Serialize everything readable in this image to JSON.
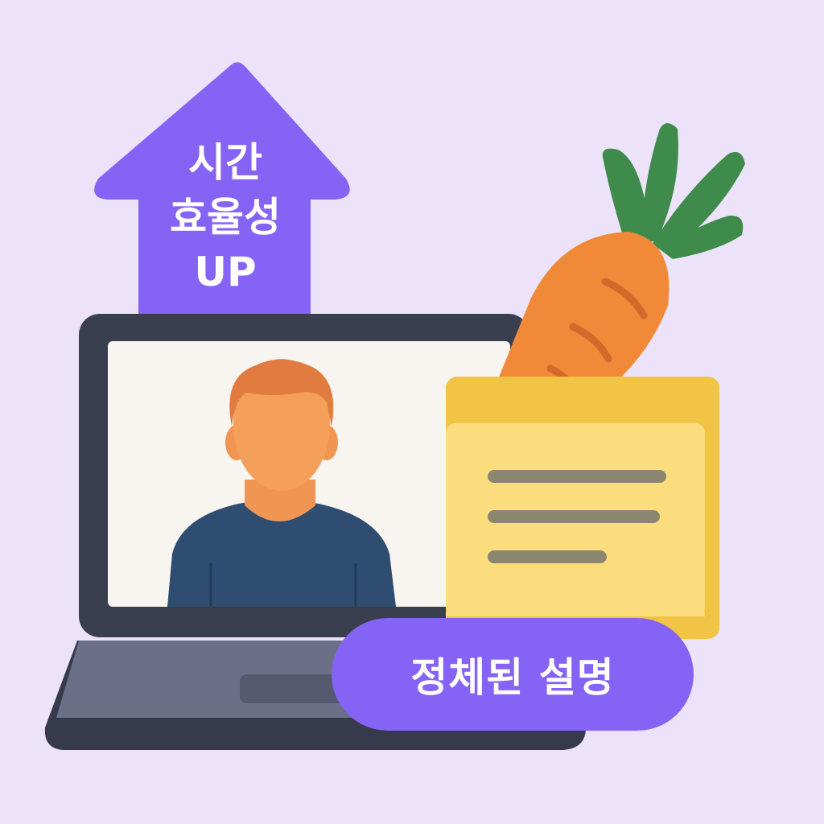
{
  "arrow_badge": {
    "line1": "시간",
    "line2": "효율성",
    "line3": "UP"
  },
  "bottom_badge": {
    "text": "정체된 설명"
  },
  "colors": {
    "background": "#ece3fa",
    "accent_purple": "#8563f4",
    "laptop_frame": "#3a3f50",
    "screen": "#f8f5f1",
    "skin": "#f5a05a",
    "hair": "#e27b3f",
    "shirt": "#2f4d70",
    "note_back": "#f2c446",
    "note_front": "#fbdd7e",
    "carrot": "#f08a38",
    "carrot_leaf": "#3f8b4b"
  },
  "icons": {
    "arrow": "up-arrow-icon",
    "laptop": "laptop-icon",
    "person": "person-avatar-icon",
    "note": "sticky-note-icon",
    "carrot": "carrot-icon"
  }
}
